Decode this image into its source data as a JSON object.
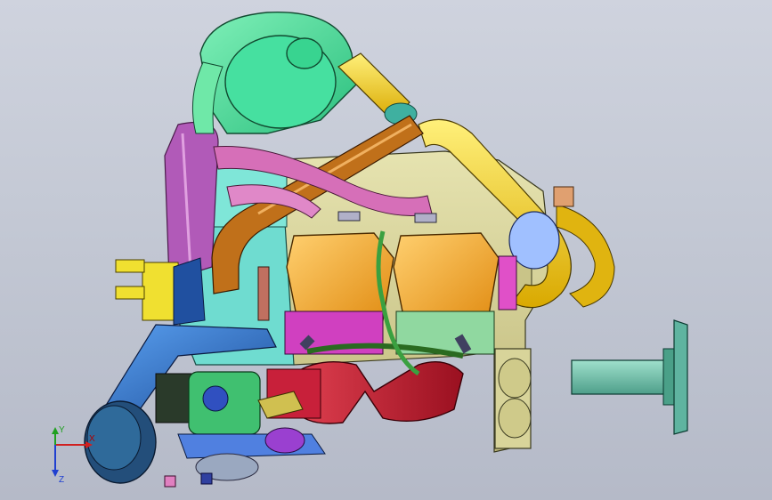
{
  "viewport": {
    "background_top": "#cfd3de",
    "background_bottom": "#b5bac8"
  },
  "model": {
    "description_icons": [
      "engine-assembly-model"
    ],
    "colors": {
      "turbo_green": "#3fe09a",
      "pipe_yellow": "#f0d020",
      "pipe_orange": "#c06a10",
      "tube_pink": "#d66fb8",
      "tube_magenta": "#b15ab8",
      "valve_cover": "#f0a020",
      "block_olive": "#d8d49a",
      "block_cyan": "#6fdcd0",
      "intake_blue": "#2f6ec8",
      "manifold_red": "#c02030",
      "shaft_teal": "#5fb4a0"
    }
  },
  "triad": {
    "x_label": "X",
    "y_label": "Y",
    "z_label": "Z",
    "x_color": "#d02020",
    "y_color": "#20a020",
    "z_color": "#2040d0"
  }
}
